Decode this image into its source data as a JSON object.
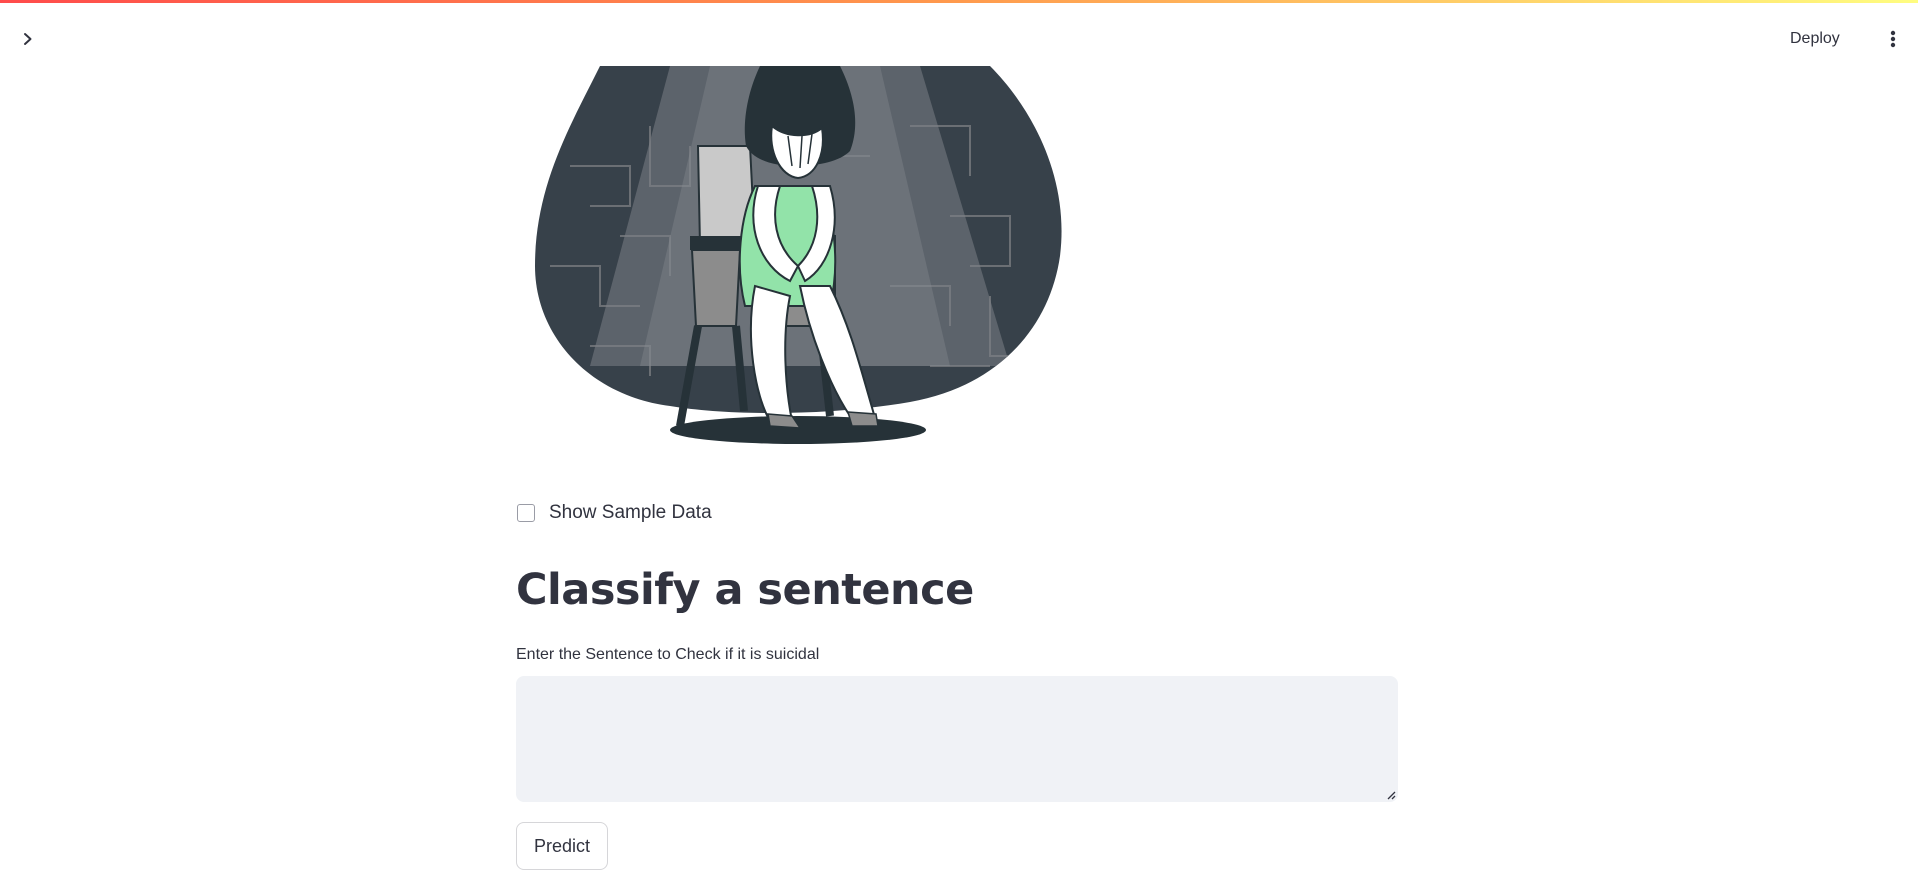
{
  "header": {
    "deploy_label": "Deploy",
    "sidebar_toggle_icon": "chevron-right-icon",
    "menu_icon": "vertical-ellipsis-icon"
  },
  "hero": {
    "image_description_icon": "sad-woman-illustration"
  },
  "checkbox": {
    "label": "Show Sample Data",
    "checked": false
  },
  "main": {
    "title": "Classify a sentence",
    "input_label": "Enter the Sentence to Check if it is suicidal",
    "input_value": "",
    "predict_label": "Predict"
  },
  "colors": {
    "accent": "#ff4b4b",
    "input_bg": "#f0f2f6",
    "text": "#31333f",
    "illustration_dark": "#37414a",
    "illustration_green": "#92e3a9"
  }
}
